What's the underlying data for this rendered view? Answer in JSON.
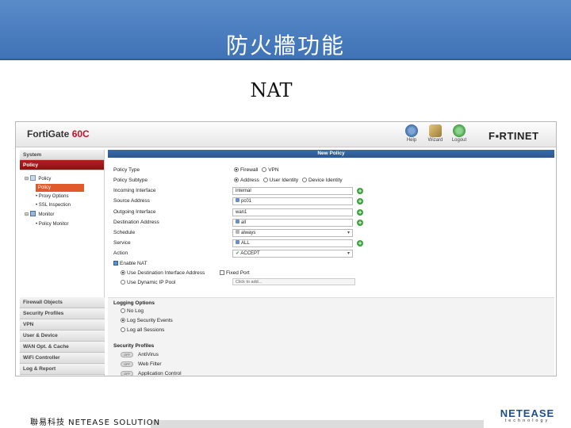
{
  "slide": {
    "title": "防火牆功能",
    "subtitle": "NAT",
    "footer": "聯易科技  NETEASE SOLUTION",
    "logo_main": "NETEASE",
    "logo_sub": "technology"
  },
  "app": {
    "brand_name": "FortiGate",
    "brand_model": "60C",
    "brand_model_color": "#c8102e",
    "vendor_logo": "F▪RTINET",
    "toolbar": [
      {
        "label": "Help",
        "icon": "help-icon"
      },
      {
        "label": "Wizard",
        "icon": "wizard-icon"
      },
      {
        "label": "Logout",
        "icon": "logout-icon"
      }
    ]
  },
  "sidebar": {
    "system": "System",
    "policy": "Policy",
    "tree": [
      "Policy",
      "Policy",
      "Proxy Options",
      "SSL Inspection",
      "Monitor",
      "Policy Monitor"
    ],
    "bottom": [
      "Firewall Objects",
      "Security Profiles",
      "VPN",
      "User & Device",
      "WAN Opt. & Cache",
      "WiFi Controller",
      "Log & Report"
    ]
  },
  "form": {
    "header": "New Policy",
    "labels": {
      "policy_type": "Policy Type",
      "policy_subtype": "Policy Subtype",
      "incoming": "Incoming Interface",
      "source": "Source Address",
      "outgoing": "Outgoing Interface",
      "destination": "Destination Address",
      "schedule": "Schedule",
      "service": "Service",
      "action": "Action"
    },
    "policy_type_options": [
      "Firewall",
      "VPN"
    ],
    "policy_subtype_options": [
      "Address",
      "User Identity",
      "Device Identity"
    ],
    "values": {
      "incoming": "internal",
      "source": "pc01",
      "outgoing": "wan1",
      "destination": "all",
      "schedule": "always",
      "service": "ALL",
      "action": "ACCEPT"
    },
    "nat": {
      "enable": "Enable NAT",
      "use_dest": "Use Destination Interface Address",
      "fixed_port": "Fixed Port",
      "dynamic_pool": "Use Dynamic IP Pool",
      "click_add": "Click to add..."
    },
    "logging": {
      "header": "Logging Options",
      "options": [
        "No Log",
        "Log Security Events",
        "Log all Sessions"
      ]
    },
    "profiles": {
      "header": "Security Profiles",
      "toggle_label": "OFF",
      "items": [
        "AntiVirus",
        "Web Filter",
        "Application Control"
      ]
    }
  },
  "colors": {
    "header_blue": "#3f73b6",
    "policy_active": "#b32020",
    "tree_selected": "#e05a2b",
    "add_green": "#3aa13a"
  }
}
